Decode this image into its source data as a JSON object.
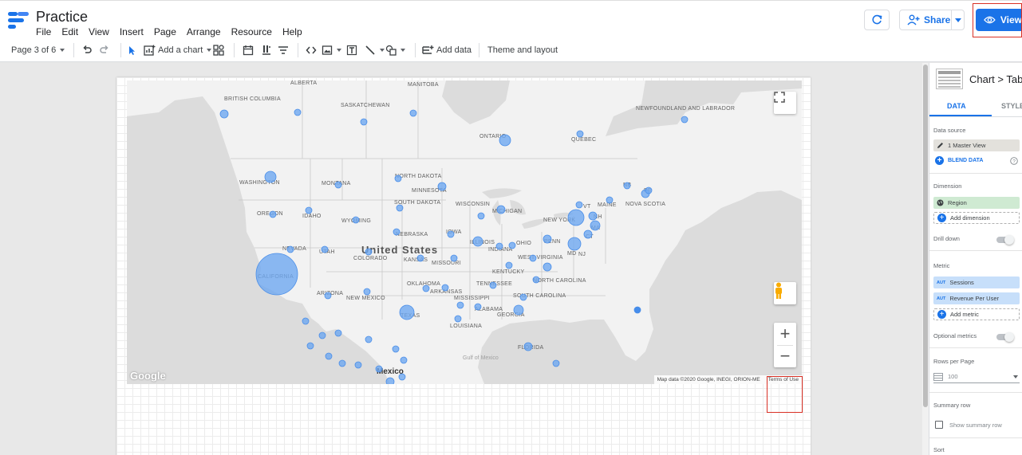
{
  "app": {
    "title": "Practice",
    "menu": [
      "File",
      "Edit",
      "View",
      "Insert",
      "Page",
      "Arrange",
      "Resource",
      "Help"
    ],
    "share_label": "Share",
    "view_label": "View",
    "brand_colors": {
      "accent": "#1a73e8",
      "highlight": "#d93025"
    }
  },
  "toolbar": {
    "page_indicator": "Page 3 of 6",
    "add_chart_label": "Add a chart",
    "add_data_label": "Add data",
    "theme_label": "Theme and layout"
  },
  "map": {
    "region_labels": [
      "ALBERTA",
      "MANITOBA",
      "BRITISH COLUMBIA",
      "SASKATCHEWAN",
      "NEWFOUNDLAND AND LABRADOR",
      "ONTARIO",
      "QUEBEC",
      "WASHINGTON",
      "MONTANA",
      "NORTH DAKOTA",
      "MINNESOTA",
      "SOUTH DAKOTA",
      "WISCONSIN",
      "MICHIGAN",
      "OREGON",
      "IDAHO",
      "WYOMING",
      "NEW YORK",
      "VT",
      "MAINE",
      "NB",
      "PE",
      "NOVA SCOTIA",
      "NH",
      "MA",
      "CT",
      "NEBRASKA",
      "IOWA",
      "ILLINOIS",
      "OHIO",
      "PENN",
      "NEVADA",
      "UTAH",
      "COLORADO",
      "KANSAS",
      "MISSOURI",
      "INDIANA",
      "WEST VIRGINIA",
      "MD",
      "NJ",
      "KENTUCKY",
      "CALIFORNIA",
      "OKLAHOMA",
      "ARKANSAS",
      "TENNESSEE",
      "NORTH CAROLINA",
      "ARIZONA",
      "NEW MEXICO",
      "MISSISSIPPI",
      "SOUTH CAROLINA",
      "ALABAMA",
      "GEORGIA",
      "TEXAS",
      "LOUISIANA",
      "FLORIDA"
    ],
    "country_label": "United States",
    "city_label": "Mexico",
    "water_label": "Gulf of Mexico",
    "google_logo": "Google",
    "attribution": "Map data ©2020 Google, INEGI, ORION-ME",
    "terms": "Terms of Use",
    "zoom_in": "+",
    "zoom_out": "−"
  },
  "panel": {
    "chart_title": "Chart > Tab",
    "tab_data": "DATA",
    "tab_style": "STYLE",
    "data_source_title": "Data source",
    "data_source_value": "1 Master View",
    "blend_data": "BLEND DATA",
    "dimension_title": "Dimension",
    "dimension_value": "Region",
    "add_dimension": "Add dimension",
    "drill_down": "Drill down",
    "metric_title": "Metric",
    "metrics": [
      "Sessions",
      "Revenue Per User"
    ],
    "aut_badge": "AUT",
    "add_metric": "Add metric",
    "optional_metrics": "Optional metrics",
    "rows_per_page_title": "Rows per Page",
    "rows_per_page_value": "100",
    "summary_row_title": "Summary row",
    "show_summary_row": "Show summary row",
    "sort_title": "Sort"
  }
}
